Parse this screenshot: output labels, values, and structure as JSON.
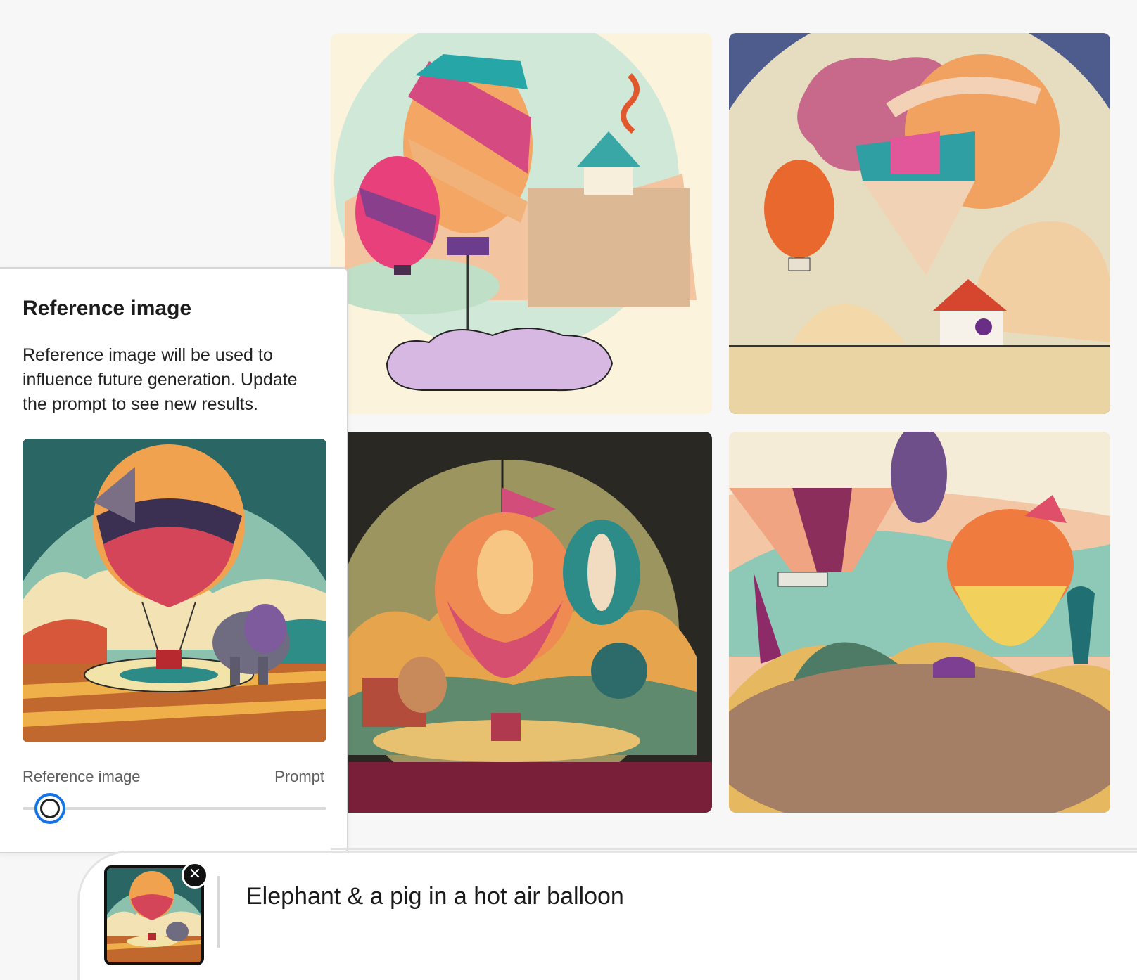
{
  "results": {
    "tiles": [
      {
        "name": "generated-image-1",
        "icon": "hot-air-balloons-house-cloud-illustration"
      },
      {
        "name": "generated-image-2",
        "icon": "hot-air-balloons-hut-desert-illustration"
      },
      {
        "name": "generated-image-3",
        "icon": "hot-air-balloons-night-circle-illustration"
      },
      {
        "name": "generated-image-4",
        "icon": "hot-air-balloons-elephant-hills-illustration"
      }
    ]
  },
  "reference_panel": {
    "title": "Reference image",
    "description": "Reference image will be used to influence future generation. Update the prompt to see new results.",
    "image_icon": "hot-air-balloon-elephant-illustration",
    "slider": {
      "left_label": "Reference image",
      "right_label": "Prompt",
      "value": 0.09
    }
  },
  "prompt_bar": {
    "text": "Elephant & a pig in a hot air balloon",
    "remove_glyph": "✕"
  },
  "colors": {
    "accent": "#1473e6",
    "panel_border": "#d6d6d6",
    "background": "#f7f7f7"
  }
}
